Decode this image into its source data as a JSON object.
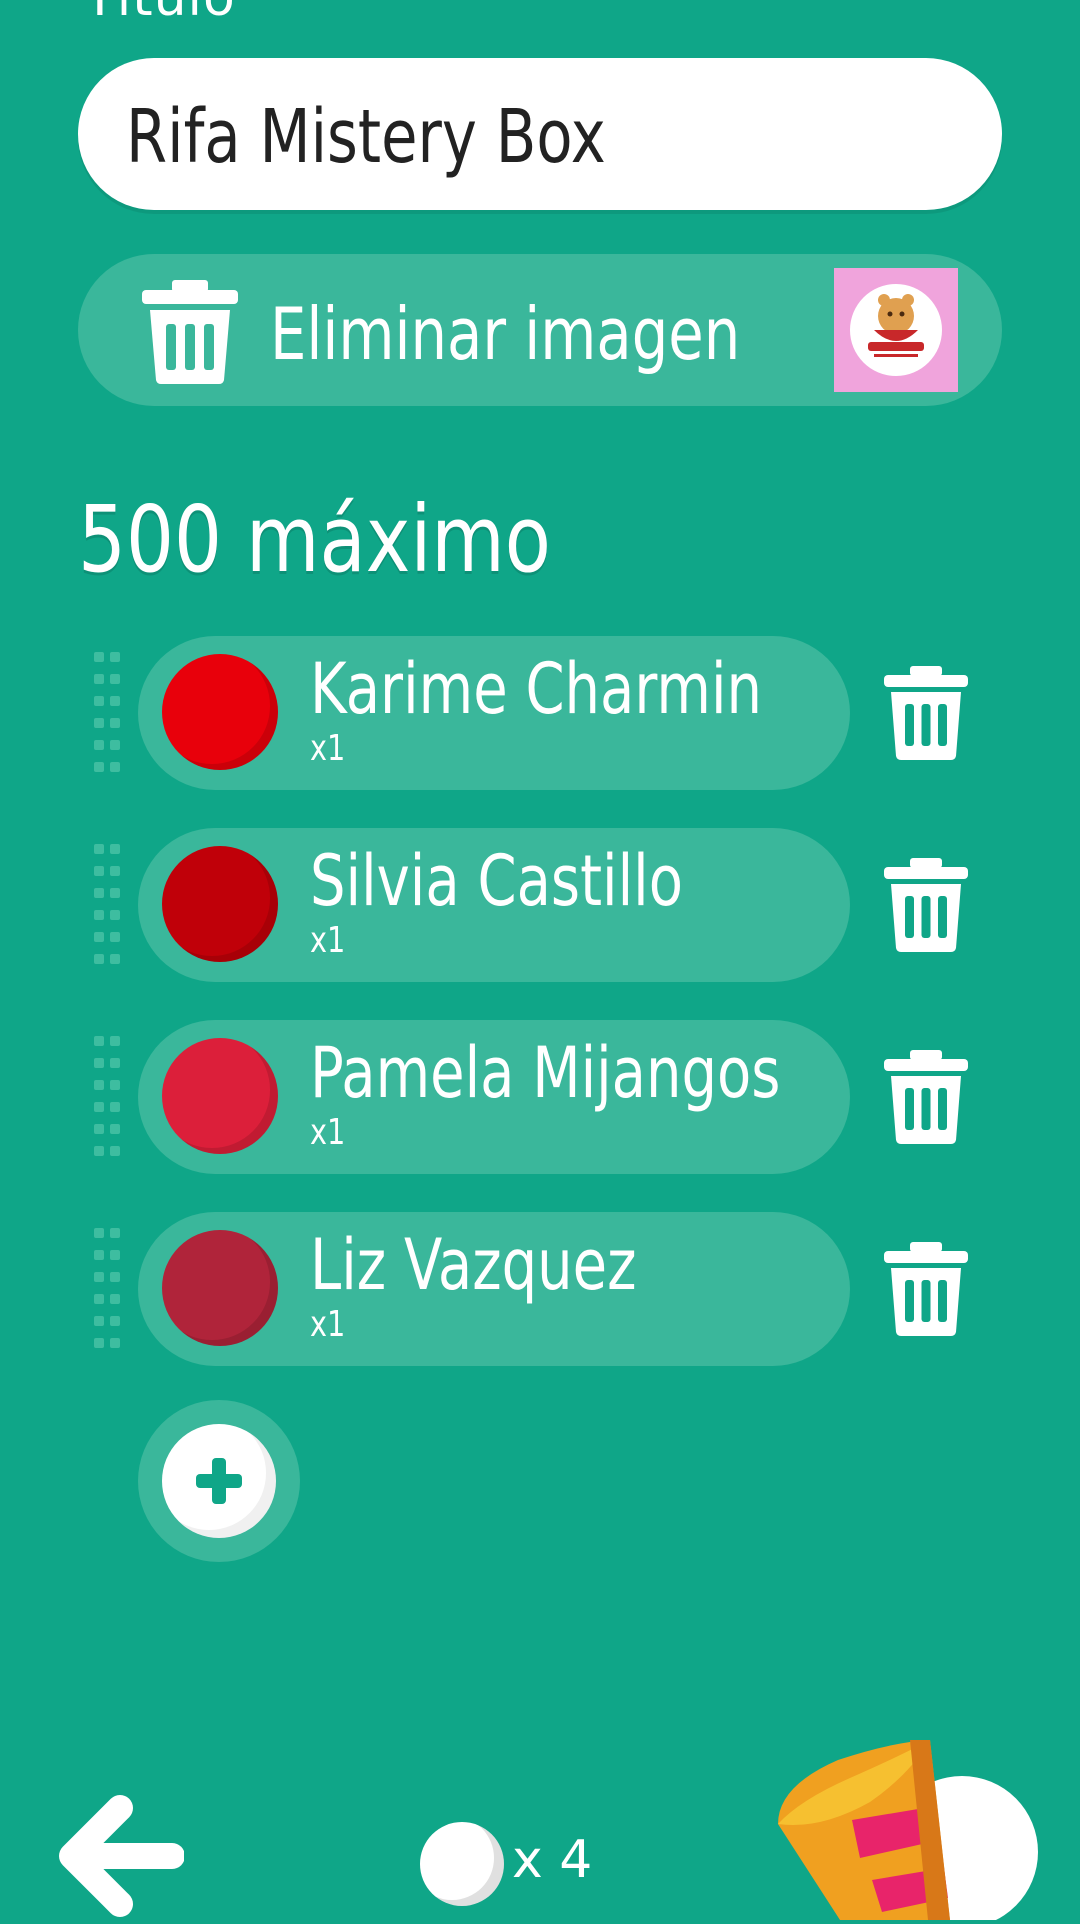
{
  "form": {
    "title_section_label": "Título",
    "title_value": "Rifa Mistery Box",
    "remove_image_label": "Eliminar imagen",
    "max_label": "500 máximo"
  },
  "participants": [
    {
      "name": "Karime Charmin",
      "count": "x1",
      "color": "#e8000b"
    },
    {
      "name": "Silvia Castillo",
      "count": "x1",
      "color": "#c00009"
    },
    {
      "name": "Pamela Mijangos",
      "count": "x1",
      "color": "#dc1f3a"
    },
    {
      "name": "Liz Vazquez",
      "count": "x1",
      "color": "#b0243a"
    }
  ],
  "footer": {
    "ball_count": "x 4"
  },
  "colors": {
    "background": "#0fa688",
    "pill": "#3ab79b",
    "accent": "#0fa688"
  },
  "icons": {
    "back": "arrow-left-icon",
    "add": "plus-icon",
    "delete": "trash-icon",
    "launch": "party-popper-icon"
  }
}
